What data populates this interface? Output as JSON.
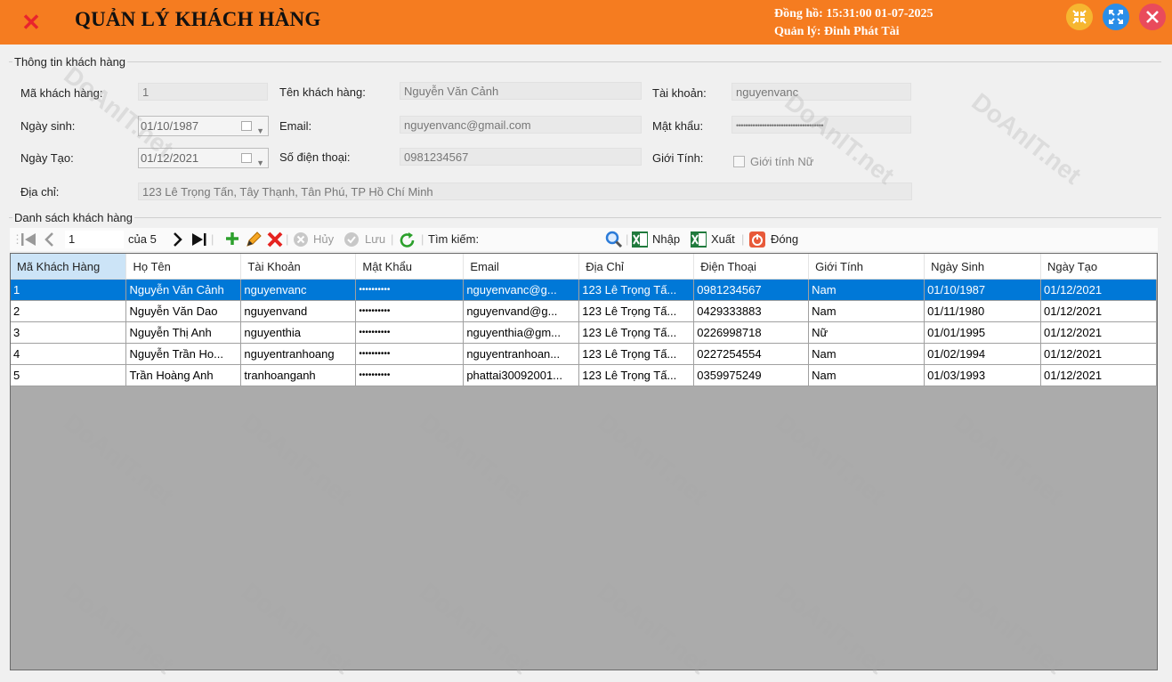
{
  "header": {
    "title": "QUẢN LÝ KHÁCH HÀNG",
    "clock": "Đồng hồ: 15:31:00 01-07-2025",
    "manager": "Quản lý: Đinh Phát Tài"
  },
  "info_group": {
    "title": "Thông tin khách hàng",
    "id_label": "Mã khách hàng:",
    "id_value": "1",
    "name_label": "Tên khách hàng:",
    "name_value": "Nguyễn Văn Cảnh",
    "account_label": "Tài khoản:",
    "account_value": "nguyenvanc",
    "birth_label": "Ngày sinh:",
    "birth_value": "01/10/1987",
    "email_label": "Email:",
    "email_value": "nguyenvanc@gmail.com",
    "password_label": "Mật khẩu:",
    "password_value": "•••••••••••••••••••••••••••••••••••••",
    "created_label": "Ngày Tạo:",
    "created_value": "01/12/2021",
    "phone_label": "Số điện thoại:",
    "phone_value": "0981234567",
    "gender_label": "Giới Tính:",
    "gender_checkbox_label": "Giới tính Nữ",
    "address_label": "Địa chỉ:",
    "address_value": "123 Lê Trọng Tấn, Tây Thạnh, Tân Phú, TP Hồ Chí Minh"
  },
  "list_group": {
    "title": "Danh sách khách hàng"
  },
  "toolbar": {
    "position": "1",
    "count": "của 5",
    "cancel": "Hủy",
    "save": "Lưu",
    "search_label": "Tìm kiếm:",
    "import": "Nhập",
    "export": "Xuất",
    "close": "Đóng"
  },
  "grid": {
    "columns": [
      "Mã Khách Hàng",
      "Họ Tên",
      "Tài Khoản",
      "Mật Khẩu",
      "Email",
      "Địa Chỉ",
      "Điện Thoại",
      "Giới Tính",
      "Ngày Sinh",
      "Ngày Tạo"
    ],
    "rows": [
      [
        "1",
        "Nguyễn Văn Cảnh",
        "nguyenvanc",
        "••••••••••",
        "nguyenvanc@g...",
        "123 Lê Trọng Tấ...",
        "0981234567",
        "Nam",
        "01/10/1987",
        "01/12/2021"
      ],
      [
        "2",
        "Nguyễn Văn Dao",
        "nguyenvand",
        "••••••••••",
        "nguyenvand@g...",
        "123 Lê Trọng Tấ...",
        "0429333883",
        "Nam",
        "01/11/1980",
        "01/12/2021"
      ],
      [
        "3",
        "Nguyễn Thị Anh",
        "nguyenthia",
        "••••••••••",
        "nguyenthia@gm...",
        "123 Lê Trọng Tấ...",
        "0226998718",
        "Nữ",
        "01/01/1995",
        "01/12/2021"
      ],
      [
        "4",
        "Nguyễn Trần Ho...",
        "nguyentranhoang",
        "••••••••••",
        "nguyentranhoan...",
        "123 Lê Trọng Tấ...",
        "0227254554",
        "Nam",
        "01/02/1994",
        "01/12/2021"
      ],
      [
        "5",
        "Trần Hoàng Anh",
        "tranhoanganh",
        "••••••••••",
        "phattai30092001...",
        "123 Lê Trọng Tấ...",
        "0359975249",
        "Nam",
        "01/03/1993",
        "01/12/2021"
      ]
    ]
  },
  "watermark": "DoAnIT.net",
  "colors": {
    "titlebar": "#f57c20",
    "selection": "#0078d7",
    "close": "#e8242d"
  }
}
